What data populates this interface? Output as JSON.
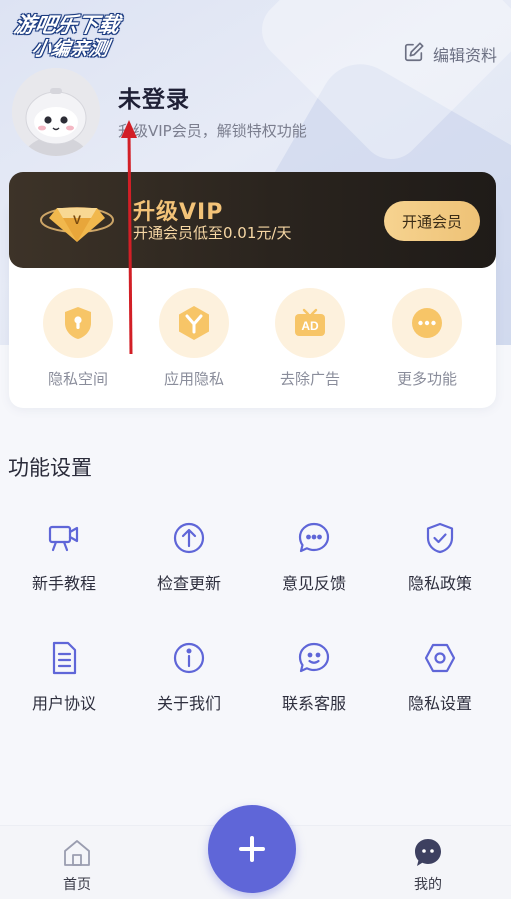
{
  "watermark": {
    "line1": "游吧乐下载",
    "line2": "小编亲测"
  },
  "header": {
    "edit_label": "编辑资料"
  },
  "profile": {
    "username": "未登录",
    "subtitle": "升级VIP会员，解锁特权功能"
  },
  "vip": {
    "title": "升级VIP",
    "desc": "开通会员低至0.01元/天",
    "button": "开通会员"
  },
  "features": [
    {
      "label": "隐私空间",
      "icon": "shield-lock-icon"
    },
    {
      "label": "应用隐私",
      "icon": "hexagon-y-icon"
    },
    {
      "label": "去除广告",
      "icon": "ad-icon"
    },
    {
      "label": "更多功能",
      "icon": "more-dots-icon"
    }
  ],
  "settings": {
    "title": "功能设置",
    "items": [
      {
        "label": "新手教程",
        "icon": "video-camera-icon"
      },
      {
        "label": "检查更新",
        "icon": "upload-arrow-icon"
      },
      {
        "label": "意见反馈",
        "icon": "chat-bubble-icon"
      },
      {
        "label": "隐私政策",
        "icon": "shield-check-icon"
      },
      {
        "label": "用户协议",
        "icon": "document-icon"
      },
      {
        "label": "关于我们",
        "icon": "info-icon"
      },
      {
        "label": "联系客服",
        "icon": "customer-service-icon"
      },
      {
        "label": "隐私设置",
        "icon": "settings-hexagon-icon"
      }
    ]
  },
  "nav": {
    "home": "首页",
    "mine": "我的"
  },
  "colors": {
    "accent": "#5f66d8",
    "vip_gold": "#f3c378",
    "feature_orange": "#f7c567"
  }
}
